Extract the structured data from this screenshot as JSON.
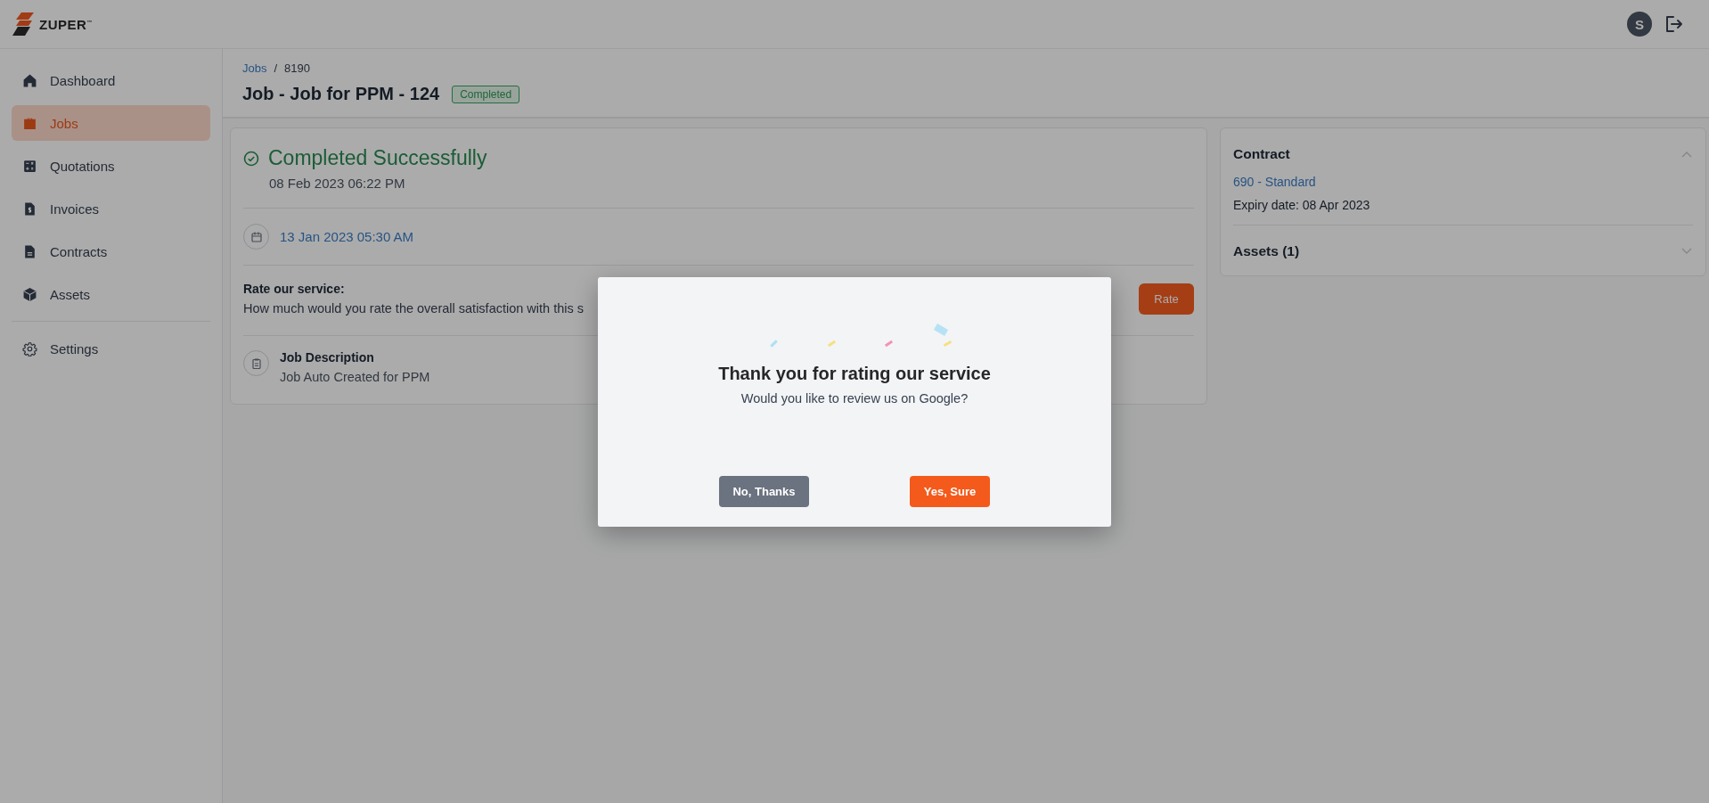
{
  "header": {
    "logo": "ZUPER$^{™}$",
    "avatar": "S"
  },
  "sidebar": {
    "items": [
      {
        "label": "Dashboard",
        "kind": "home",
        "selected": false
      },
      {
        "label": "Jobs",
        "kind": "briefcase",
        "selected": true
      },
      {
        "label": "Quotations",
        "kind": "calculator",
        "selected": false
      },
      {
        "label": "Invoices",
        "kind": "invoice",
        "selected": false
      },
      {
        "label": "Contracts",
        "kind": "document",
        "selected": false
      },
      {
        "label": "Assets",
        "kind": "cube",
        "selected": false
      }
    ],
    "footer_items": [
      {
        "label": "Settings",
        "kind": "gear",
        "selected": false
      }
    ]
  },
  "breadcrumb": {
    "separator": "/",
    "items": [
      "Jobs",
      "8190"
    ]
  },
  "title": "Job - Job for PPM - 124",
  "status_badge": "Completed",
  "status": {
    "title": "Completed Successfully",
    "time": "08 Feb 2023 06:22 PM"
  },
  "scheduled": "13 Jan 2023 05:30 AM",
  "rating": {
    "label": "Rate our service:",
    "question": "How much would you rate the overall satisfaction with this s",
    "button": "Rate"
  },
  "description": {
    "label": "Job Description",
    "text": "Job Auto Created for PPM"
  },
  "side_panel": {
    "sections": [
      {
        "title": "Contract",
        "expanded": true,
        "link": "690 - Standard",
        "detail": "Expiry date: 08 Apr 2023"
      },
      {
        "title": "Assets (1)",
        "expanded": false
      }
    ]
  },
  "modal": {
    "title": "Thank you for rating our service",
    "message": "Would you like to review us on Google?",
    "buttons": [
      {
        "label": "No, Thanks",
        "kind": "secondary"
      },
      {
        "label": "Yes, Sure",
        "kind": "primary"
      }
    ]
  }
}
